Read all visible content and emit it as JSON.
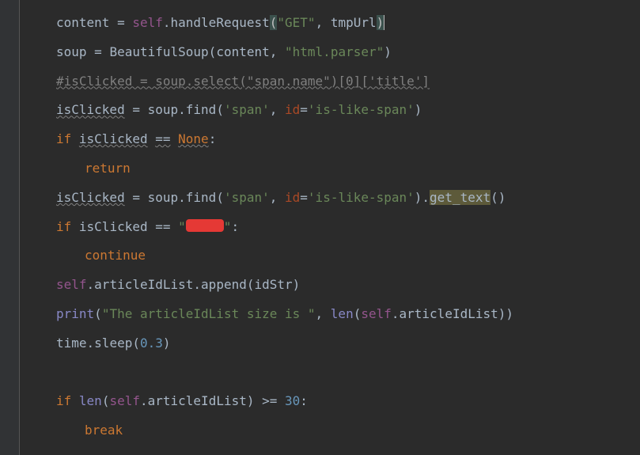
{
  "lines": {
    "l1_content": "content",
    "l1_self": "self",
    "l1_method": "handleRequest",
    "l1_arg1": "\"GET\"",
    "l1_arg2": "tmpUrl",
    "l2_soup": "soup",
    "l2_bs": "BeautifulSoup",
    "l2_content": "content",
    "l2_parser": "\"html.parser\"",
    "l3_comment": "#isClicked = soup.select(\"span.name\")[0]['title']",
    "l4_var": "isClicked",
    "l4_soup": "soup",
    "l4_find": "find",
    "l4_span": "'span'",
    "l4_idkey": "id",
    "l4_idval": "'is-like-span'",
    "l5_if": "if",
    "l5_var": "isClicked",
    "l5_eq": "==",
    "l5_none": "None",
    "l6_return": "return",
    "l7_var": "isClicked",
    "l7_soup": "soup",
    "l7_find": "find",
    "l7_span": "'span'",
    "l7_idkey": "id",
    "l7_idval": "'is-like-span'",
    "l7_gettext": "get_text",
    "l8_if": "if",
    "l8_var": "isClicked",
    "l8_eq": "==",
    "l8_q1": "\"",
    "l8_q2": "\"",
    "l9_continue": "continue",
    "l10_self": "self",
    "l10_list": "articleIdList",
    "l10_append": "append",
    "l10_arg": "idStr",
    "l11_print": "print",
    "l11_str": "\"The articleIdList size is \"",
    "l11_len": "len",
    "l11_self": "self",
    "l11_list": "articleIdList",
    "l12_time": "time",
    "l12_sleep": "sleep",
    "l12_val": "0.3",
    "l13_if": "if",
    "l13_len": "len",
    "l13_self": "self",
    "l13_list": "articleIdList",
    "l13_ge": ">=",
    "l13_num": "30",
    "l14_break": "break"
  }
}
